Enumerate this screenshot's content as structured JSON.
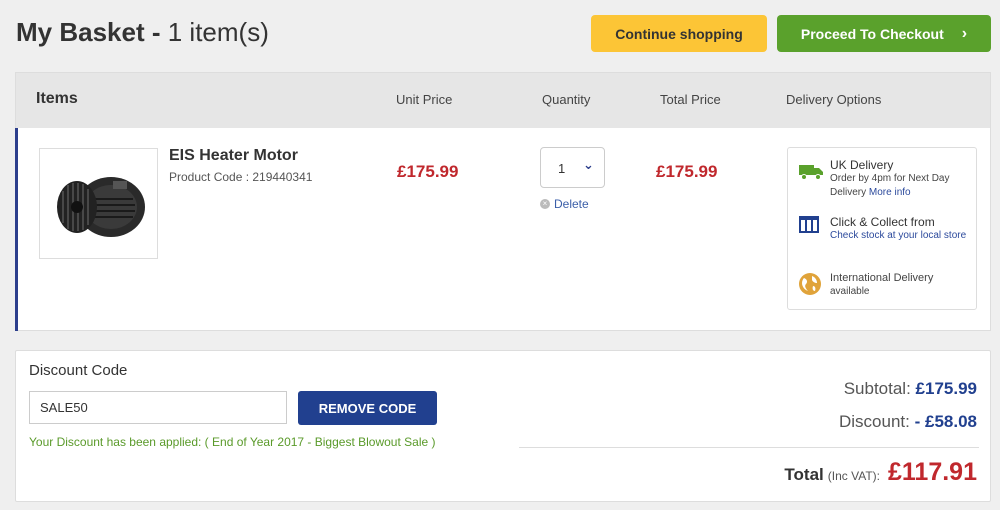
{
  "page": {
    "title_main": "My Basket -",
    "title_count": "1 item(s)"
  },
  "actions": {
    "continue_label": "Continue shopping",
    "checkout_label": "Proceed To Checkout"
  },
  "basket": {
    "headers": {
      "items": "Items",
      "unit_price": "Unit Price",
      "quantity": "Quantity",
      "total_price": "Total Price",
      "delivery": "Delivery Options"
    },
    "item": {
      "name": "EIS Heater Motor",
      "code": "Product Code : 219440341",
      "unit_price": "£175.99",
      "quantity": "1",
      "delete_label": "Delete",
      "total_price": "£175.99",
      "image_icon": "heater-motor-image"
    },
    "delivery_options": {
      "uk_title": "UK Delivery",
      "uk_line1": "Order by 4pm for Next Day",
      "uk_line2": "Delivery",
      "uk_link": "More info",
      "collect_title": "Click & Collect from",
      "collect_link": "Check stock at your local store",
      "intl_title": "International Delivery",
      "intl_line2": "available"
    }
  },
  "discount": {
    "label": "Discount Code",
    "code_value": "SALE50",
    "remove_label": "REMOVE CODE",
    "message": "Your Discount has been applied: ( End of Year 2017 - Biggest Blowout Sale )"
  },
  "totals": {
    "subtotal_label": "Subtotal:",
    "subtotal_value": "£175.99",
    "discount_label": "Discount:",
    "discount_value": "- £58.08",
    "total_label": "Total",
    "total_inc": "(Inc VAT):",
    "total_value": "£117.91"
  },
  "colors": {
    "accent_yellow": "#fcc536",
    "accent_green": "#5aa12c",
    "brand_blue": "#21408f",
    "price_red": "#c0282d"
  }
}
